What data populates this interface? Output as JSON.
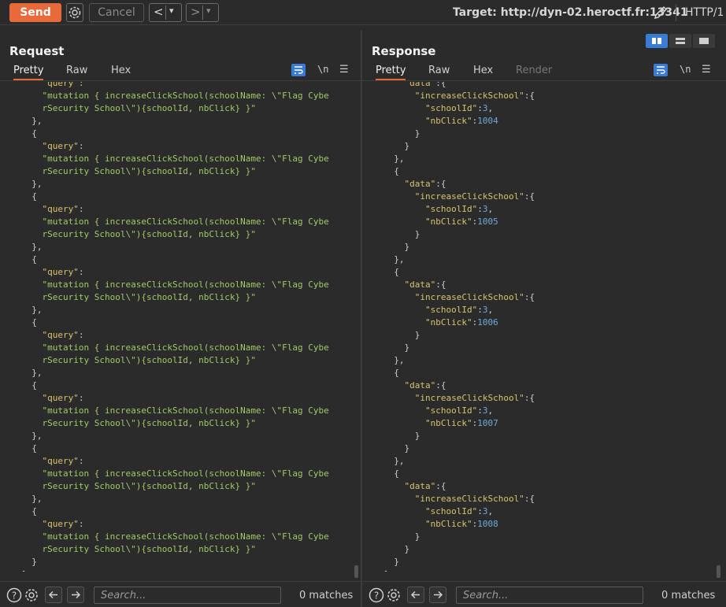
{
  "toolbar": {
    "send_label": "Send",
    "cancel_label": "Cancel",
    "back_label": "<",
    "back_dropdown": "▾",
    "forward_label": ">",
    "forward_dropdown": "▾",
    "target_label": "Target: http://dyn-02.heroctf.fr:13341",
    "protocol_label": "HTTP/1"
  },
  "request": {
    "title": "Request",
    "tabs": [
      "Pretty",
      "Raw",
      "Hex"
    ],
    "active_tab": "Pretty",
    "newline_toggle": "\\n",
    "menu_icon": "☰",
    "search_placeholder": "Search...",
    "matches": "0 matches",
    "lines": [
      [
        {
          "c": "k",
          "t": "    \"query\":"
        }
      ],
      [
        {
          "c": "s",
          "t": "    \"mutation { increaseClickSchool(schoolName: \\\"Flag Cybe"
        }
      ],
      [
        {
          "c": "s",
          "t": "    rSecurity School\\\"){schoolId, nbClick} }\""
        }
      ],
      [
        {
          "c": "p",
          "t": "  },"
        }
      ],
      [
        {
          "c": "p",
          "t": "  {"
        }
      ],
      [
        {
          "c": "k",
          "t": "    \"query\""
        },
        {
          "c": "p",
          "t": ":"
        }
      ],
      [
        {
          "c": "s",
          "t": "    \"mutation { increaseClickSchool(schoolName: \\\"Flag Cybe"
        }
      ],
      [
        {
          "c": "s",
          "t": "    rSecurity School\\\"){schoolId, nbClick} }\""
        }
      ],
      [
        {
          "c": "p",
          "t": "  },"
        }
      ],
      [
        {
          "c": "p",
          "t": "  {"
        }
      ],
      [
        {
          "c": "k",
          "t": "    \"query\""
        },
        {
          "c": "p",
          "t": ":"
        }
      ],
      [
        {
          "c": "s",
          "t": "    \"mutation { increaseClickSchool(schoolName: \\\"Flag Cybe"
        }
      ],
      [
        {
          "c": "s",
          "t": "    rSecurity School\\\"){schoolId, nbClick} }\""
        }
      ],
      [
        {
          "c": "p",
          "t": "  },"
        }
      ],
      [
        {
          "c": "p",
          "t": "  {"
        }
      ],
      [
        {
          "c": "k",
          "t": "    \"query\""
        },
        {
          "c": "p",
          "t": ":"
        }
      ],
      [
        {
          "c": "s",
          "t": "    \"mutation { increaseClickSchool(schoolName: \\\"Flag Cybe"
        }
      ],
      [
        {
          "c": "s",
          "t": "    rSecurity School\\\"){schoolId, nbClick} }\""
        }
      ],
      [
        {
          "c": "p",
          "t": "  },"
        }
      ],
      [
        {
          "c": "p",
          "t": "  {"
        }
      ],
      [
        {
          "c": "k",
          "t": "    \"query\""
        },
        {
          "c": "p",
          "t": ":"
        }
      ],
      [
        {
          "c": "s",
          "t": "    \"mutation { increaseClickSchool(schoolName: \\\"Flag Cybe"
        }
      ],
      [
        {
          "c": "s",
          "t": "    rSecurity School\\\"){schoolId, nbClick} }\""
        }
      ],
      [
        {
          "c": "p",
          "t": "  },"
        }
      ],
      [
        {
          "c": "p",
          "t": "  {"
        }
      ],
      [
        {
          "c": "k",
          "t": "    \"query\""
        },
        {
          "c": "p",
          "t": ":"
        }
      ],
      [
        {
          "c": "s",
          "t": "    \"mutation { increaseClickSchool(schoolName: \\\"Flag Cybe"
        }
      ],
      [
        {
          "c": "s",
          "t": "    rSecurity School\\\"){schoolId, nbClick} }\""
        }
      ],
      [
        {
          "c": "p",
          "t": "  },"
        }
      ],
      [
        {
          "c": "p",
          "t": "  {"
        }
      ],
      [
        {
          "c": "k",
          "t": "    \"query\""
        },
        {
          "c": "p",
          "t": ":"
        }
      ],
      [
        {
          "c": "s",
          "t": "    \"mutation { increaseClickSchool(schoolName: \\\"Flag Cybe"
        }
      ],
      [
        {
          "c": "s",
          "t": "    rSecurity School\\\"){schoolId, nbClick} }\""
        }
      ],
      [
        {
          "c": "p",
          "t": "  },"
        }
      ],
      [
        {
          "c": "p",
          "t": "  {"
        }
      ],
      [
        {
          "c": "k",
          "t": "    \"query\""
        },
        {
          "c": "p",
          "t": ":"
        }
      ],
      [
        {
          "c": "s",
          "t": "    \"mutation { increaseClickSchool(schoolName: \\\"Flag Cybe"
        }
      ],
      [
        {
          "c": "s",
          "t": "    rSecurity School\\\"){schoolId, nbClick} }\""
        }
      ],
      [
        {
          "c": "p",
          "t": "  }"
        }
      ],
      [
        {
          "c": "p",
          "t": "]"
        }
      ]
    ]
  },
  "response": {
    "title": "Response",
    "tabs": [
      "Pretty",
      "Raw",
      "Hex",
      "Render"
    ],
    "active_tab": "Pretty",
    "newline_toggle": "\\n",
    "menu_icon": "☰",
    "search_placeholder": "Search...",
    "matches": "0 matches",
    "lines": [
      [
        {
          "c": "k",
          "t": "    \"data\""
        },
        {
          "c": "p",
          "t": ":{"
        }
      ],
      [
        {
          "c": "k",
          "t": "      \"increaseClickSchool\""
        },
        {
          "c": "p",
          "t": ":{"
        }
      ],
      [
        {
          "c": "k",
          "t": "        \"schoolId\""
        },
        {
          "c": "p",
          "t": ":"
        },
        {
          "c": "n",
          "t": "3"
        },
        {
          "c": "p",
          "t": ","
        }
      ],
      [
        {
          "c": "k",
          "t": "        \"nbClick\""
        },
        {
          "c": "p",
          "t": ":"
        },
        {
          "c": "n",
          "t": "1004"
        }
      ],
      [
        {
          "c": "p",
          "t": "      }"
        }
      ],
      [
        {
          "c": "p",
          "t": "    }"
        }
      ],
      [
        {
          "c": "p",
          "t": "  },"
        }
      ],
      [
        {
          "c": "p",
          "t": "  {"
        }
      ],
      [
        {
          "c": "k",
          "t": "    \"data\""
        },
        {
          "c": "p",
          "t": ":{"
        }
      ],
      [
        {
          "c": "k",
          "t": "      \"increaseClickSchool\""
        },
        {
          "c": "p",
          "t": ":{"
        }
      ],
      [
        {
          "c": "k",
          "t": "        \"schoolId\""
        },
        {
          "c": "p",
          "t": ":"
        },
        {
          "c": "n",
          "t": "3"
        },
        {
          "c": "p",
          "t": ","
        }
      ],
      [
        {
          "c": "k",
          "t": "        \"nbClick\""
        },
        {
          "c": "p",
          "t": ":"
        },
        {
          "c": "n",
          "t": "1005"
        }
      ],
      [
        {
          "c": "p",
          "t": "      }"
        }
      ],
      [
        {
          "c": "p",
          "t": "    }"
        }
      ],
      [
        {
          "c": "p",
          "t": "  },"
        }
      ],
      [
        {
          "c": "p",
          "t": "  {"
        }
      ],
      [
        {
          "c": "k",
          "t": "    \"data\""
        },
        {
          "c": "p",
          "t": ":{"
        }
      ],
      [
        {
          "c": "k",
          "t": "      \"increaseClickSchool\""
        },
        {
          "c": "p",
          "t": ":{"
        }
      ],
      [
        {
          "c": "k",
          "t": "        \"schoolId\""
        },
        {
          "c": "p",
          "t": ":"
        },
        {
          "c": "n",
          "t": "3"
        },
        {
          "c": "p",
          "t": ","
        }
      ],
      [
        {
          "c": "k",
          "t": "        \"nbClick\""
        },
        {
          "c": "p",
          "t": ":"
        },
        {
          "c": "n",
          "t": "1006"
        }
      ],
      [
        {
          "c": "p",
          "t": "      }"
        }
      ],
      [
        {
          "c": "p",
          "t": "    }"
        }
      ],
      [
        {
          "c": "p",
          "t": "  },"
        }
      ],
      [
        {
          "c": "p",
          "t": "  {"
        }
      ],
      [
        {
          "c": "k",
          "t": "    \"data\""
        },
        {
          "c": "p",
          "t": ":{"
        }
      ],
      [
        {
          "c": "k",
          "t": "      \"increaseClickSchool\""
        },
        {
          "c": "p",
          "t": ":{"
        }
      ],
      [
        {
          "c": "k",
          "t": "        \"schoolId\""
        },
        {
          "c": "p",
          "t": ":"
        },
        {
          "c": "n",
          "t": "3"
        },
        {
          "c": "p",
          "t": ","
        }
      ],
      [
        {
          "c": "k",
          "t": "        \"nbClick\""
        },
        {
          "c": "p",
          "t": ":"
        },
        {
          "c": "n",
          "t": "1007"
        }
      ],
      [
        {
          "c": "p",
          "t": "      }"
        }
      ],
      [
        {
          "c": "p",
          "t": "    }"
        }
      ],
      [
        {
          "c": "p",
          "t": "  },"
        }
      ],
      [
        {
          "c": "p",
          "t": "  {"
        }
      ],
      [
        {
          "c": "k",
          "t": "    \"data\""
        },
        {
          "c": "p",
          "t": ":{"
        }
      ],
      [
        {
          "c": "k",
          "t": "      \"increaseClickSchool\""
        },
        {
          "c": "p",
          "t": ":{"
        }
      ],
      [
        {
          "c": "k",
          "t": "        \"schoolId\""
        },
        {
          "c": "p",
          "t": ":"
        },
        {
          "c": "n",
          "t": "3"
        },
        {
          "c": "p",
          "t": ","
        }
      ],
      [
        {
          "c": "k",
          "t": "        \"nbClick\""
        },
        {
          "c": "p",
          "t": ":"
        },
        {
          "c": "n",
          "t": "1008"
        }
      ],
      [
        {
          "c": "p",
          "t": "      }"
        }
      ],
      [
        {
          "c": "p",
          "t": "    }"
        }
      ],
      [
        {
          "c": "p",
          "t": "  }"
        }
      ],
      [
        {
          "c": "p",
          "t": "]"
        }
      ]
    ]
  },
  "colors": {
    "accent": "#e8693a",
    "active_blue": "#3a7bd5",
    "json_key": "#d9c26a",
    "json_string": "#9fca68",
    "json_number": "#6ea8dd",
    "background": "#2b2b2b"
  },
  "icons": {
    "settings": "gear-icon",
    "edit_target": "pencil-icon",
    "help": "help-icon",
    "search_settings": "gear-icon",
    "prev": "arrow-left-icon",
    "next": "arrow-right-icon",
    "wrap": "wrap-lines-icon"
  }
}
